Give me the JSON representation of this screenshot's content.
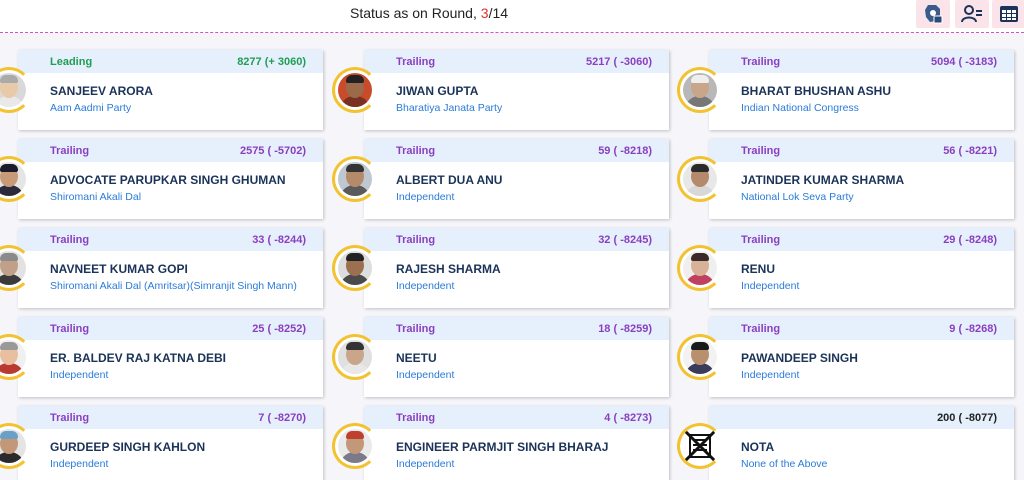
{
  "status": {
    "prefix": "Status as on Round,",
    "current_round": "3",
    "separator": "/",
    "total_rounds": "14"
  },
  "toolbar": {
    "buttons": [
      {
        "icon": "constituency-icon"
      },
      {
        "icon": "candidate-list-icon"
      },
      {
        "icon": "table-grid-icon"
      }
    ]
  },
  "candidates": [
    {
      "status": "Leading",
      "votes": "8277 (+ 3060)",
      "name": "SANJEEV ARORA",
      "party": "Aam Aadmi Party"
    },
    {
      "status": "Trailing",
      "votes": "5217 ( -3060)",
      "name": "JIWAN GUPTA",
      "party": "Bharatiya Janata Party"
    },
    {
      "status": "Trailing",
      "votes": "5094 ( -3183)",
      "name": "BHARAT BHUSHAN ASHU",
      "party": "Indian National Congress"
    },
    {
      "status": "Trailing",
      "votes": "2575 ( -5702)",
      "name": "ADVOCATE PARUPKAR SINGH GHUMAN",
      "party": "Shiromani Akali Dal"
    },
    {
      "status": "Trailing",
      "votes": "59 ( -8218)",
      "name": "ALBERT DUA ANU",
      "party": "Independent"
    },
    {
      "status": "Trailing",
      "votes": "56 ( -8221)",
      "name": "JATINDER KUMAR SHARMA",
      "party": "National Lok Seva Party"
    },
    {
      "status": "Trailing",
      "votes": "33 ( -8244)",
      "name": "NAVNEET KUMAR GOPI",
      "party": "Shiromani Akali Dal (Amritsar)(Simranjit Singh Mann)"
    },
    {
      "status": "Trailing",
      "votes": "32 ( -8245)",
      "name": "RAJESH SHARMA",
      "party": "Independent"
    },
    {
      "status": "Trailing",
      "votes": "29 ( -8248)",
      "name": "RENU",
      "party": "Independent"
    },
    {
      "status": "Trailing",
      "votes": "25 ( -8252)",
      "name": "ER. BALDEV RAJ KATNA DEBI",
      "party": "Independent"
    },
    {
      "status": "Trailing",
      "votes": "18 ( -8259)",
      "name": "NEETU",
      "party": "Independent"
    },
    {
      "status": "Trailing",
      "votes": "9 ( -8268)",
      "name": "PAWANDEEP SINGH",
      "party": "Independent"
    },
    {
      "status": "Trailing",
      "votes": "7 ( -8270)",
      "name": "GURDEEP SINGH KAHLON",
      "party": "Independent"
    },
    {
      "status": "Trailing",
      "votes": "4 ( -8273)",
      "name": "ENGINEER PARMJIT SINGH BHARAJ",
      "party": "Independent"
    },
    {
      "status": "",
      "votes": "200 ( -8077)",
      "name": "NOTA",
      "party": "None of the Above"
    }
  ],
  "colors": {
    "leading": "#1f9d55",
    "trailing": "#8a3fbf",
    "party": "#2a7bd8",
    "ring": "#f2c230",
    "header_bg": "#e6f0fc"
  }
}
